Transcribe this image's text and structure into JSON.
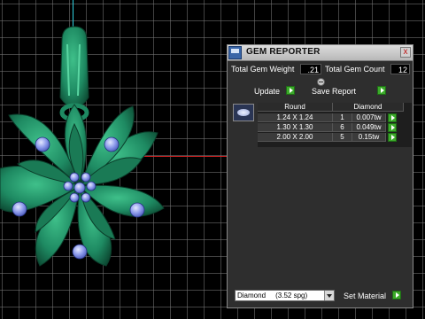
{
  "panel": {
    "title": "GEM REPORTER",
    "close_glyph": "x",
    "total_gem_weight_label": "Total Gem Weight",
    "total_gem_weight_value": ".21",
    "total_gem_count_label": "Total Gem Count",
    "total_gem_count_value": "12",
    "update_label": "Update",
    "save_report_label": "Save Report",
    "table": {
      "headers": [
        "Round",
        "Diamond"
      ],
      "rows": [
        {
          "size": "1.24 X 1.24",
          "count": "1",
          "weight": "0.007tw"
        },
        {
          "size": "1.30 X 1.30",
          "count": "6",
          "weight": "0.049tw"
        },
        {
          "size": "2.00 X 2.00",
          "count": "5",
          "weight": "0.15tw"
        }
      ]
    },
    "material_select_value": "Diamond     (3.52 spg)",
    "set_material_label": "Set Material"
  },
  "colors": {
    "metal_green": "#1e8a62",
    "gem_blue": "#7f8fe6",
    "go_green": "#3caa2a",
    "axis_cyan": "#2fd0e0",
    "axis_red": "#d02020"
  },
  "icons": [
    "gem-reporter-icon",
    "close-icon",
    "collapse-icon",
    "go-arrow-icon",
    "round-gem-icon",
    "dropdown-arrow-icon"
  ]
}
